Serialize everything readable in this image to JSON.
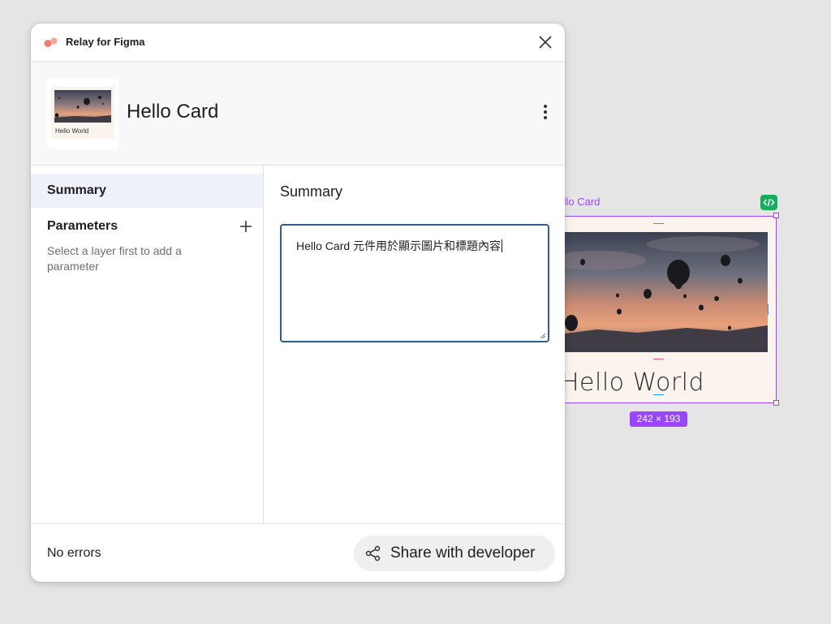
{
  "plugin": {
    "title": "Relay for Figma",
    "component_name": "Hello Card",
    "thumbnail_text": "Hello World",
    "sidebar": {
      "summary_label": "Summary",
      "parameters_label": "Parameters",
      "parameters_hint": "Select a layer first to add a parameter"
    },
    "main": {
      "title": "Summary",
      "summary_value": "Hello Card 元件用於顯示圖片和標題內容"
    },
    "footer": {
      "status": "No errors",
      "share_label": "Share with developer"
    }
  },
  "canvas": {
    "frame_label": "Hello Card",
    "frame_title": "Hello World",
    "size_badge": "242 × 193"
  },
  "colors": {
    "selection": "#9747ff",
    "code_badge": "#14ae5c",
    "relay_logo": "#f47c6b",
    "focus_border": "#2e5d93"
  },
  "icons": {
    "relay_logo": "relay-logo",
    "close": "close-icon",
    "more": "more-vert-icon",
    "add": "add-icon",
    "share": "share-icon",
    "code": "code-icon"
  }
}
